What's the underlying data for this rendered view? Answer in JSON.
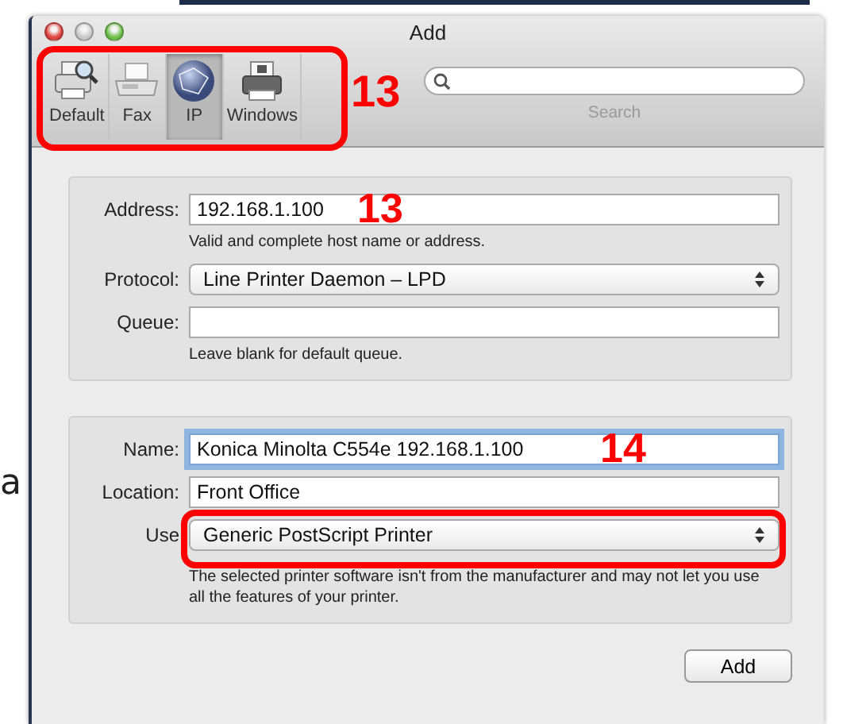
{
  "side_text": "a",
  "window": {
    "title": "Add"
  },
  "toolbar": {
    "highlighted": true,
    "annotation": "13",
    "items": [
      {
        "label": "Default",
        "kind": "printer-search",
        "selected": false
      },
      {
        "label": "Fax",
        "kind": "fax",
        "selected": false
      },
      {
        "label": "IP",
        "kind": "globe",
        "selected": true
      },
      {
        "label": "Windows",
        "kind": "printer",
        "selected": false
      }
    ],
    "search": {
      "label": "Search"
    }
  },
  "address_panel": {
    "fields": [
      {
        "kind": "text",
        "label": "Address:",
        "value": "192.168.1.100",
        "annotation": "13",
        "hint": "Valid and complete host name or address."
      },
      {
        "kind": "popup",
        "label": "Protocol:",
        "value": "Line Printer Daemon – LPD"
      },
      {
        "kind": "text",
        "label": "Queue:",
        "hint": "Leave blank for default queue."
      }
    ]
  },
  "printer_panel": {
    "fields": [
      {
        "kind": "text",
        "label": "Name:",
        "value": "Konica Minolta C554e 192.168.1.100",
        "focused": true,
        "annotation": "14"
      },
      {
        "kind": "text",
        "label": "Location:",
        "value": "Front Office",
        "focused": false
      },
      {
        "kind": "popup",
        "label": "Use",
        "value": "Generic PostScript Printer",
        "highlighted": true,
        "hint": "The selected printer software isn't from the manufacturer and may not let you use all the features of your printer."
      }
    ]
  },
  "buttons": [
    "Add"
  ]
}
